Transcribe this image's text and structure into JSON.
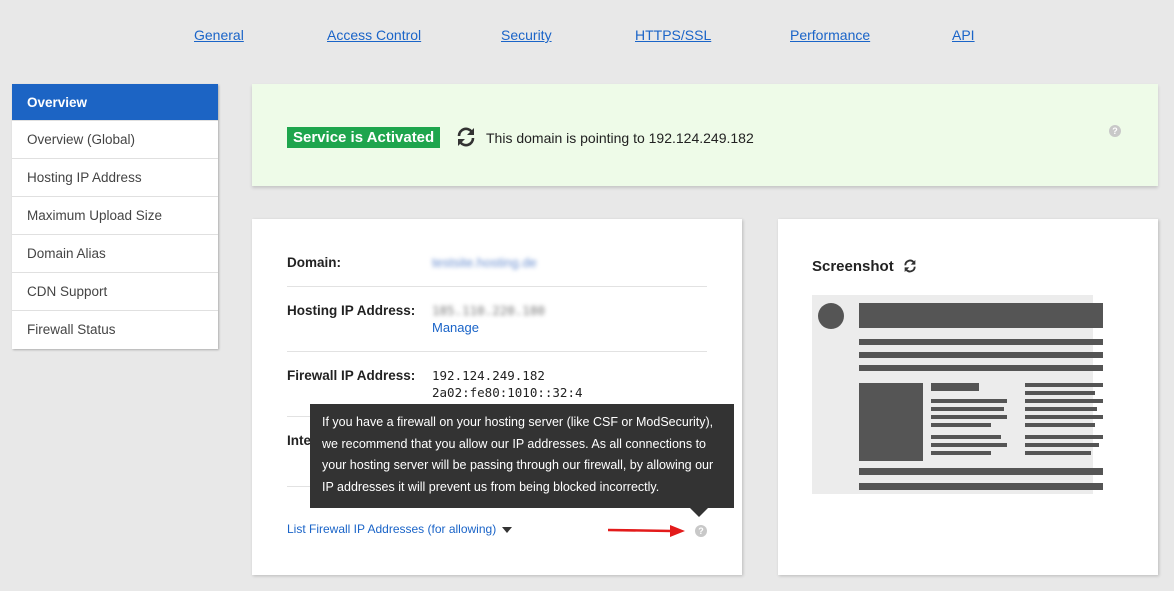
{
  "topnav": {
    "items": [
      "General",
      "Access Control",
      "Security",
      "HTTPS/SSL",
      "Performance",
      "API"
    ]
  },
  "sidebar": {
    "items": [
      "Overview",
      "Overview (Global)",
      "Hosting IP Address",
      "Maximum Upload Size",
      "Domain Alias",
      "CDN Support",
      "Firewall Status"
    ],
    "active_index": 0
  },
  "banner": {
    "status": "Service is Activated",
    "pointing_text": "This domain is pointing to 192.124.249.182",
    "help": "?"
  },
  "info": {
    "domain_label": "Domain:",
    "domain_value": "testsite.hosting.de",
    "hosting_label": "Hosting IP Address:",
    "hosting_value": "185.110.220.180",
    "manage_link": "Manage",
    "firewall_label": "Firewall IP Address:",
    "firewall_ipv4": "192.124.249.182",
    "firewall_ipv6": "2a02:fe80:1010::32:4",
    "internal_label_fragment": "Inte",
    "list_link": "List Firewall IP Addresses (for allowing)",
    "help": "?"
  },
  "tooltip": {
    "text": "If you have a firewall on your hosting server (like CSF or ModSecurity), we recommend that you allow our IP addresses. As all connections to your hosting server will be passing through our firewall, by allowing our IP addresses it will prevent us from being blocked incorrectly."
  },
  "screenshot": {
    "title": "Screenshot"
  },
  "colors": {
    "accent": "#1c64c4",
    "link": "#1a64c8",
    "success": "#1ea54d",
    "banner_bg": "#eefbe8",
    "tooltip_bg": "#333333",
    "arrow": "#e31b1b"
  }
}
